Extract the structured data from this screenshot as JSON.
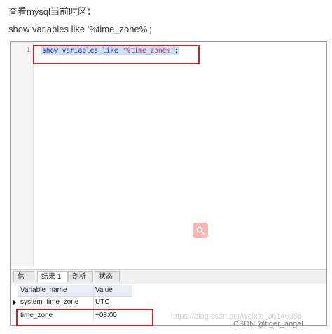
{
  "article": {
    "heading": "查看mysql当前时区：",
    "command": "show variables like '%time_zone%';"
  },
  "editor": {
    "line_number": "1",
    "code": {
      "kw1": "show variables like",
      "str": "'%time_zone%'",
      "end": ";"
    }
  },
  "tabs": {
    "info": "信息",
    "result1": "结果 1",
    "profile": "剖析",
    "status": "状态",
    "active": "result1"
  },
  "result_table": {
    "columns": [
      "Variable_name",
      "Value"
    ],
    "rows": [
      [
        "system_time_zone",
        "UTC"
      ],
      [
        "time_zone",
        "+08:00"
      ]
    ],
    "current_row": 0
  },
  "watermark": {
    "faint": "https://blog.csdn.net/weixin_36146358",
    "mark": "CSDN @tiger_angel"
  },
  "icons": {
    "row_indicator": "row-pointer-icon",
    "center_logo": "search-icon"
  },
  "colors": {
    "highlight_box": "#c8202c",
    "selection": "#cfe0f5",
    "keyword": "#2323c8",
    "string": "#b0307a"
  }
}
